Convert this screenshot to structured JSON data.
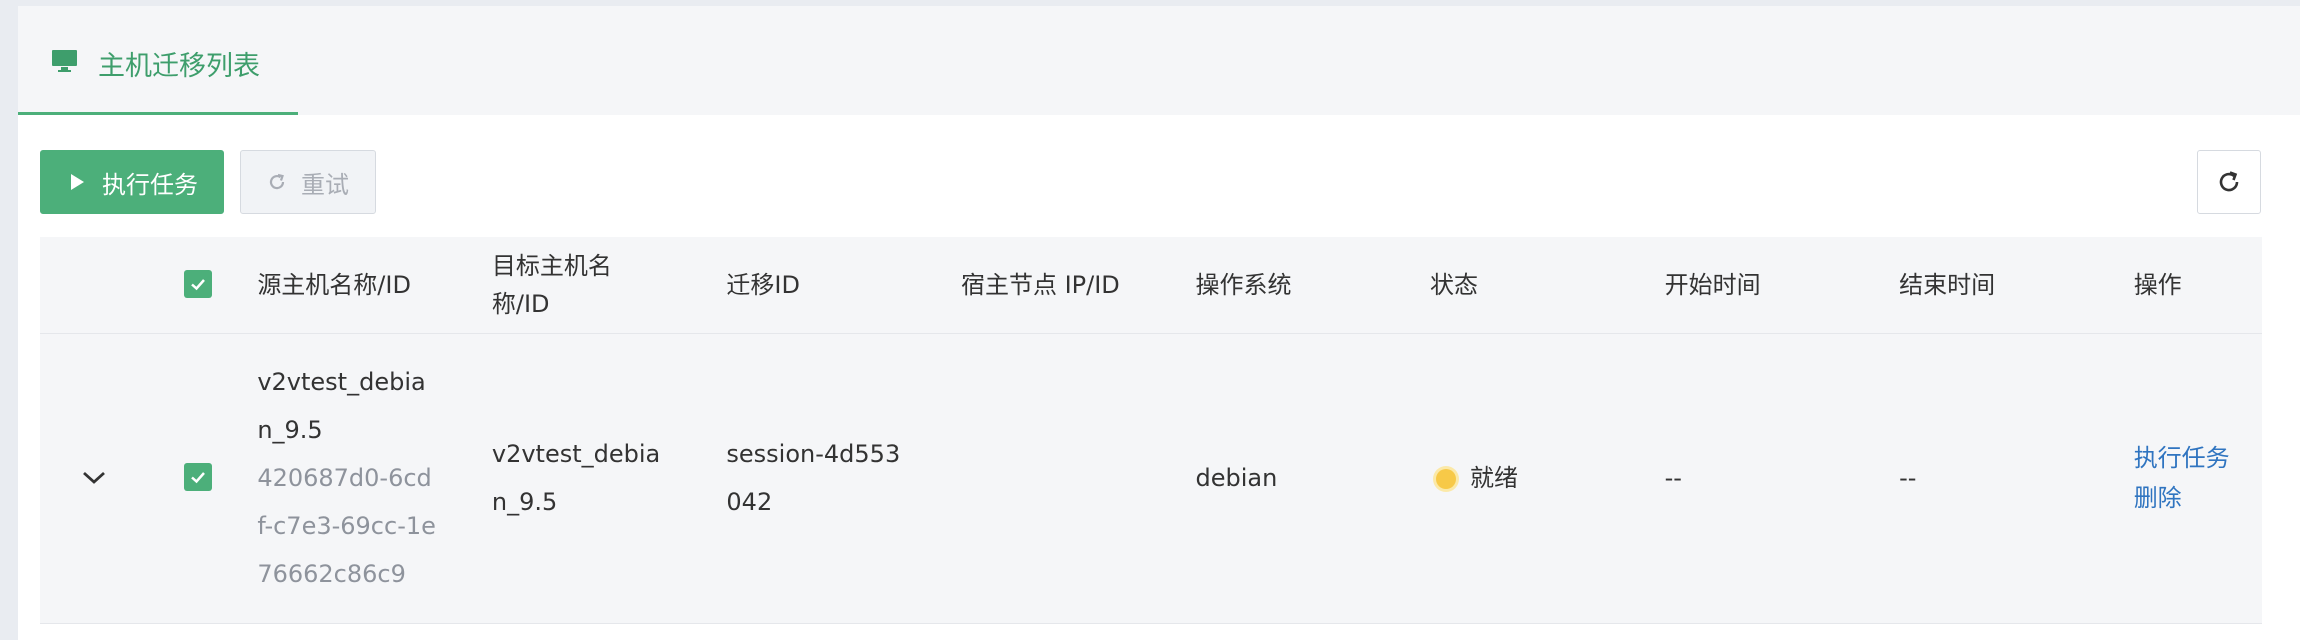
{
  "header": {
    "title": "主机迁移列表",
    "icon": "monitor-icon"
  },
  "toolbar": {
    "run_label": "执行任务",
    "retry_label": "重试",
    "refresh_icon": "refresh-icon"
  },
  "table": {
    "columns": {
      "source": "源主机名称/ID",
      "target_line1": "目标主机名",
      "target_line2": "称/ID",
      "migration_id": "迁移ID",
      "host_node": "宿主节点 IP/ID",
      "os": "操作系统",
      "status": "状态",
      "start_time": "开始时间",
      "end_time": "结束时间",
      "actions": "操作"
    },
    "rows": [
      {
        "source_name_1": "v2vtest_debia",
        "source_name_2": "n_9.5",
        "source_id_1": "420687d0-6cd",
        "source_id_2": "f-c7e3-69cc-1e",
        "source_id_3": "76662c86c9",
        "target_1": "v2vtest_debia",
        "target_2": "n_9.5",
        "migration_id_1": "session-4d553",
        "migration_id_2": "042",
        "host_node": "",
        "os": "debian",
        "status": "就绪",
        "status_color": "#f7c948",
        "start_time": "--",
        "end_time": "--",
        "action_run": "执行任务",
        "action_delete": "删除"
      }
    ]
  },
  "colors": {
    "accent": "#4caf7a",
    "link": "#2f74c0"
  }
}
